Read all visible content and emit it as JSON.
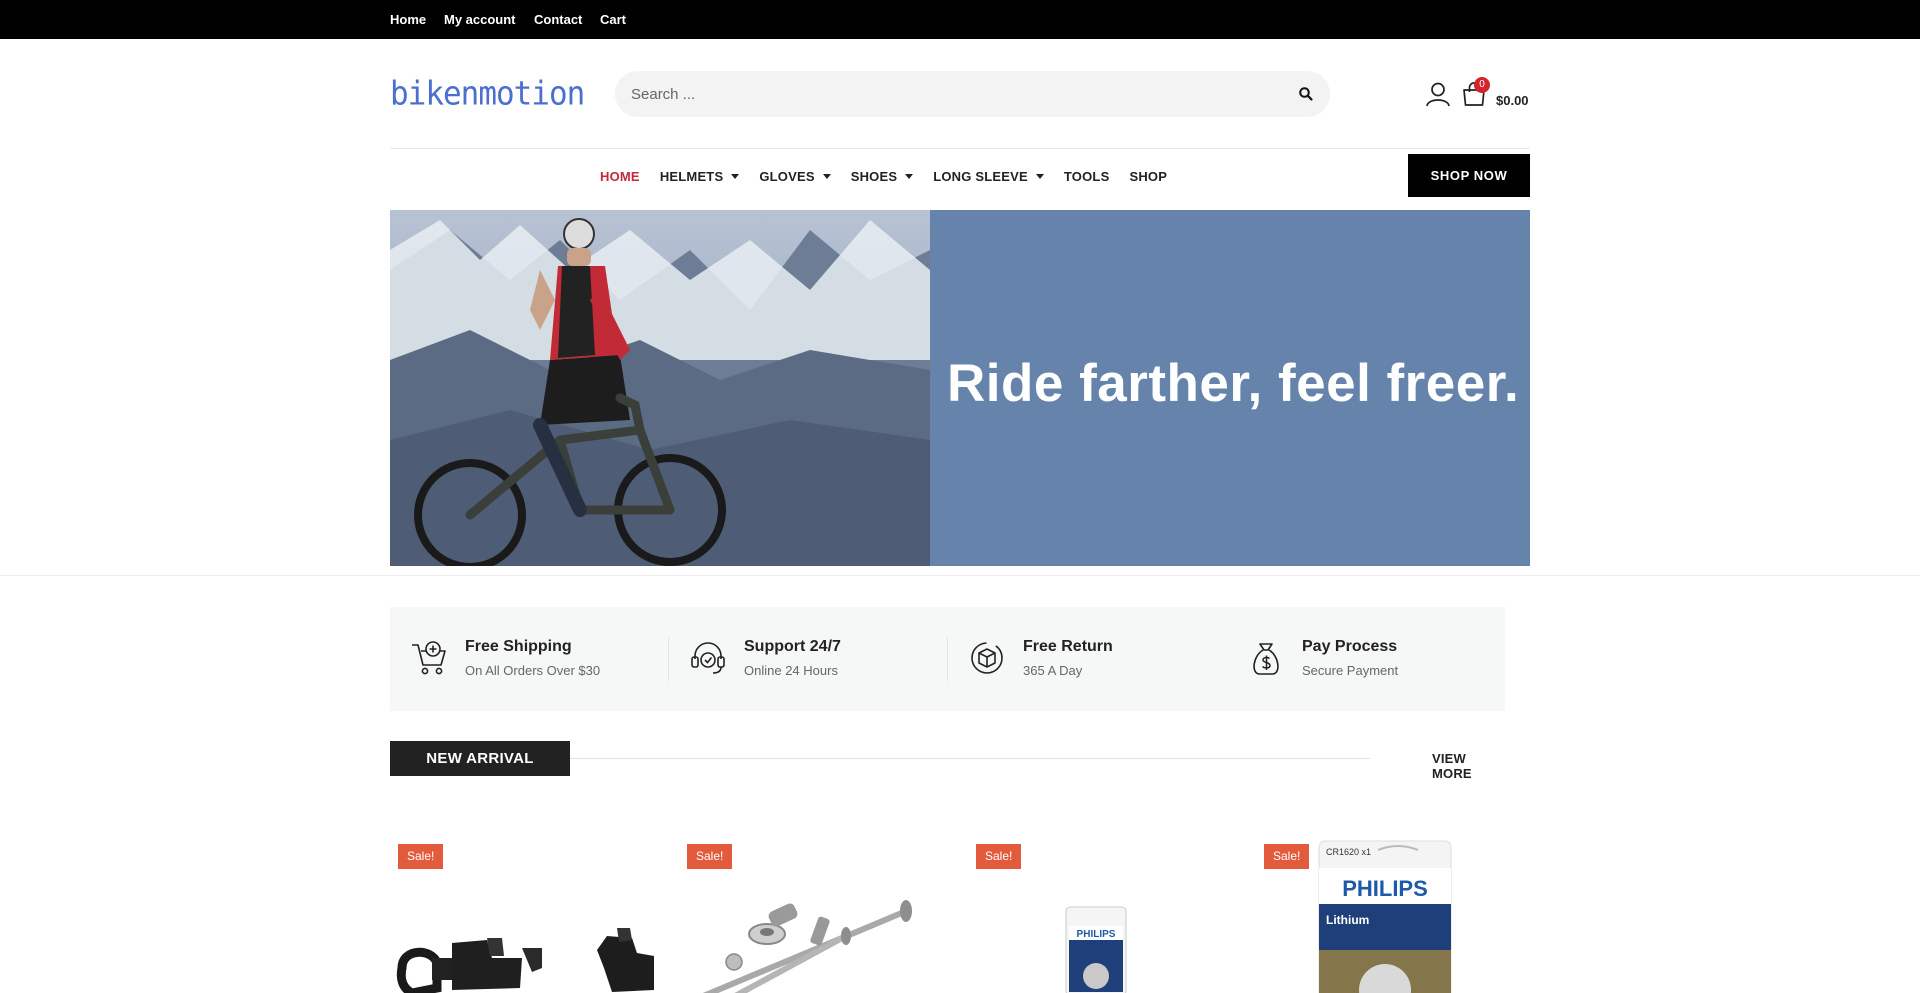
{
  "topbar": {
    "links": [
      "Home",
      "My account",
      "Contact",
      "Cart"
    ]
  },
  "header": {
    "logo": "bikenmotion",
    "search_placeholder": "Search ...",
    "cart_count": "0",
    "cart_total": "$0.00"
  },
  "nav": {
    "items": [
      {
        "label": "HOME",
        "active": true,
        "dropdown": false
      },
      {
        "label": "HELMETS",
        "active": false,
        "dropdown": true
      },
      {
        "label": "GLOVES",
        "active": false,
        "dropdown": true
      },
      {
        "label": "SHOES",
        "active": false,
        "dropdown": true
      },
      {
        "label": "LONG SLEEVE",
        "active": false,
        "dropdown": true
      },
      {
        "label": "TOOLS",
        "active": false,
        "dropdown": false
      },
      {
        "label": "SHOP",
        "active": false,
        "dropdown": false
      }
    ],
    "cta": "SHOP NOW"
  },
  "hero": {
    "headline": "Ride farther, feel freer.",
    "panel_color": "#6583ab"
  },
  "features": [
    {
      "icon": "cart-plus-icon",
      "title": "Free Shipping",
      "subtitle": "On All Orders Over $30"
    },
    {
      "icon": "headset-icon",
      "title": "Support 24/7",
      "subtitle": "Online 24 Hours"
    },
    {
      "icon": "box-return-icon",
      "title": "Free Return",
      "subtitle": "365 A Day"
    },
    {
      "icon": "money-bag-icon",
      "title": "Pay Process",
      "subtitle": "Secure Payment"
    }
  ],
  "new_arrival": {
    "title": "NEW ARRIVAL",
    "view_more": "VIEW MORE",
    "products": [
      {
        "badge": "Sale!",
        "image": "phone-mount-image"
      },
      {
        "badge": "Sale!",
        "image": "skewer-set-image"
      },
      {
        "badge": "Sale!",
        "image": "philips-battery-small-image",
        "brand": "PHILIPS"
      },
      {
        "badge": "Sale!",
        "image": "philips-battery-large-image",
        "brand": "PHILIPS",
        "model": "CR1620 x1",
        "type": "Lithium"
      }
    ]
  },
  "colors": {
    "accent_red": "#c5283d",
    "sale_orange": "#e35b3d",
    "logo_blue": "#4b6fd1"
  }
}
